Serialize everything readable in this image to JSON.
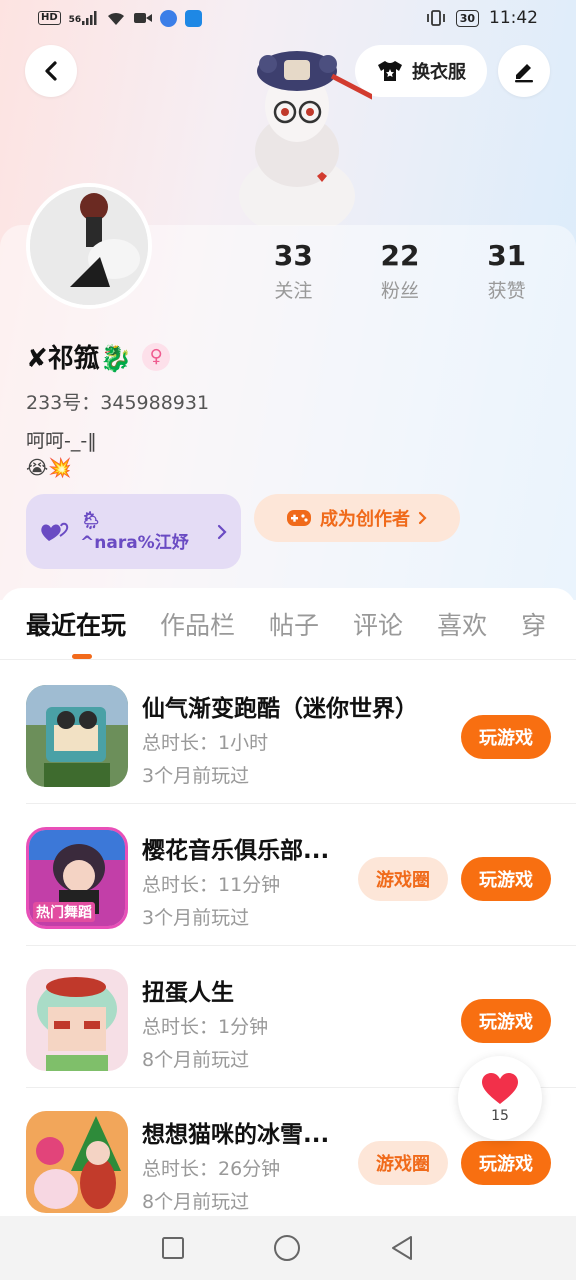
{
  "status_bar": {
    "hd": "HD",
    "signal": "56",
    "battery": "30",
    "time": "11:42"
  },
  "header": {
    "dress_label": "换衣服"
  },
  "profile": {
    "stats": [
      {
        "value": "33",
        "label": "关注"
      },
      {
        "value": "22",
        "label": "粉丝"
      },
      {
        "value": "31",
        "label": "获赞"
      }
    ],
    "username": "✘祁箛🐉",
    "gender_symbol": "♀",
    "uid": "233号：345988931",
    "bio_line1": "呵呵-_-‖",
    "bio_line2": "😭💥",
    "tag_line1": "🌦",
    "tag_line2": "^nara%江妤",
    "creator_label": "成为创作者"
  },
  "tabs": [
    "最近在玩",
    "作品栏",
    "帖子",
    "评论",
    "喜欢",
    "穿"
  ],
  "games": [
    {
      "name": "仙气渐变跑酷（迷你世界）",
      "duration": "总时长：1小时",
      "last_played": "3个月前玩过",
      "play_label": "玩游戏",
      "icon": "mini-world-icon",
      "icon_label": ""
    },
    {
      "name": "樱花音乐俱乐部...",
      "duration": "总时长：11分钟",
      "last_played": "3个月前玩过",
      "play_label": "玩游戏",
      "circle_label": "游戏圈",
      "icon": "sakura-music-icon",
      "icon_label": "热门舞蹈"
    },
    {
      "name": "扭蛋人生",
      "duration": "总时长：1分钟",
      "last_played": "8个月前玩过",
      "play_label": "玩游戏",
      "icon": "gacha-life-icon",
      "icon_label": ""
    },
    {
      "name": "想想猫咪的冰雪...",
      "duration": "总时长：26分钟",
      "last_played": "8个月前玩过",
      "play_label": "玩游戏",
      "circle_label": "游戏圈",
      "icon": "snow-cat-icon",
      "icon_label": ""
    }
  ],
  "float_like": {
    "count": "15"
  },
  "colors": {
    "accent": "#f86f11",
    "accent_light": "#fde6d8",
    "tag_bg": "#e4dcf5",
    "tag_text": "#6a4bc3"
  }
}
